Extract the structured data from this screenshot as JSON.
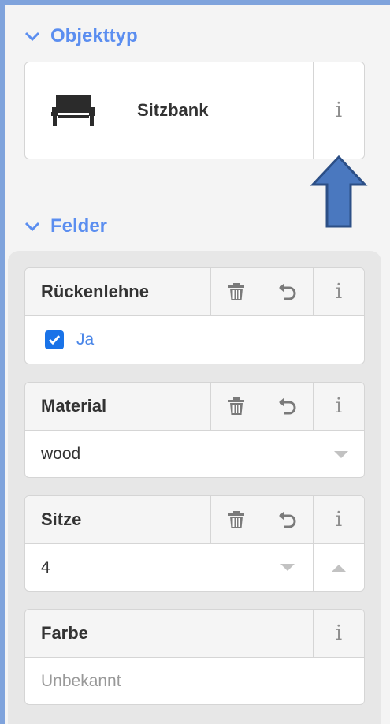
{
  "objecttype_section": {
    "title": "Objekttyp",
    "object_name": "Sitzbank",
    "info_symbol": "i",
    "icon": "bench-icon"
  },
  "fields_section": {
    "title": "Felder",
    "fields": [
      {
        "label": "Rückenlehne",
        "type": "checkbox",
        "checked": true,
        "value_label": "Ja",
        "info_symbol": "i"
      },
      {
        "label": "Material",
        "type": "select",
        "value": "wood",
        "info_symbol": "i"
      },
      {
        "label": "Sitze",
        "type": "number",
        "value": "4",
        "info_symbol": "i"
      },
      {
        "label": "Farbe",
        "type": "text",
        "placeholder": "Unbekannt",
        "info_symbol": "i"
      }
    ]
  },
  "colors": {
    "accent": "#5b8ef0",
    "checkbox": "#1a73e8",
    "arrow_fill": "#4a78bf",
    "arrow_stroke": "#2c4f86"
  }
}
